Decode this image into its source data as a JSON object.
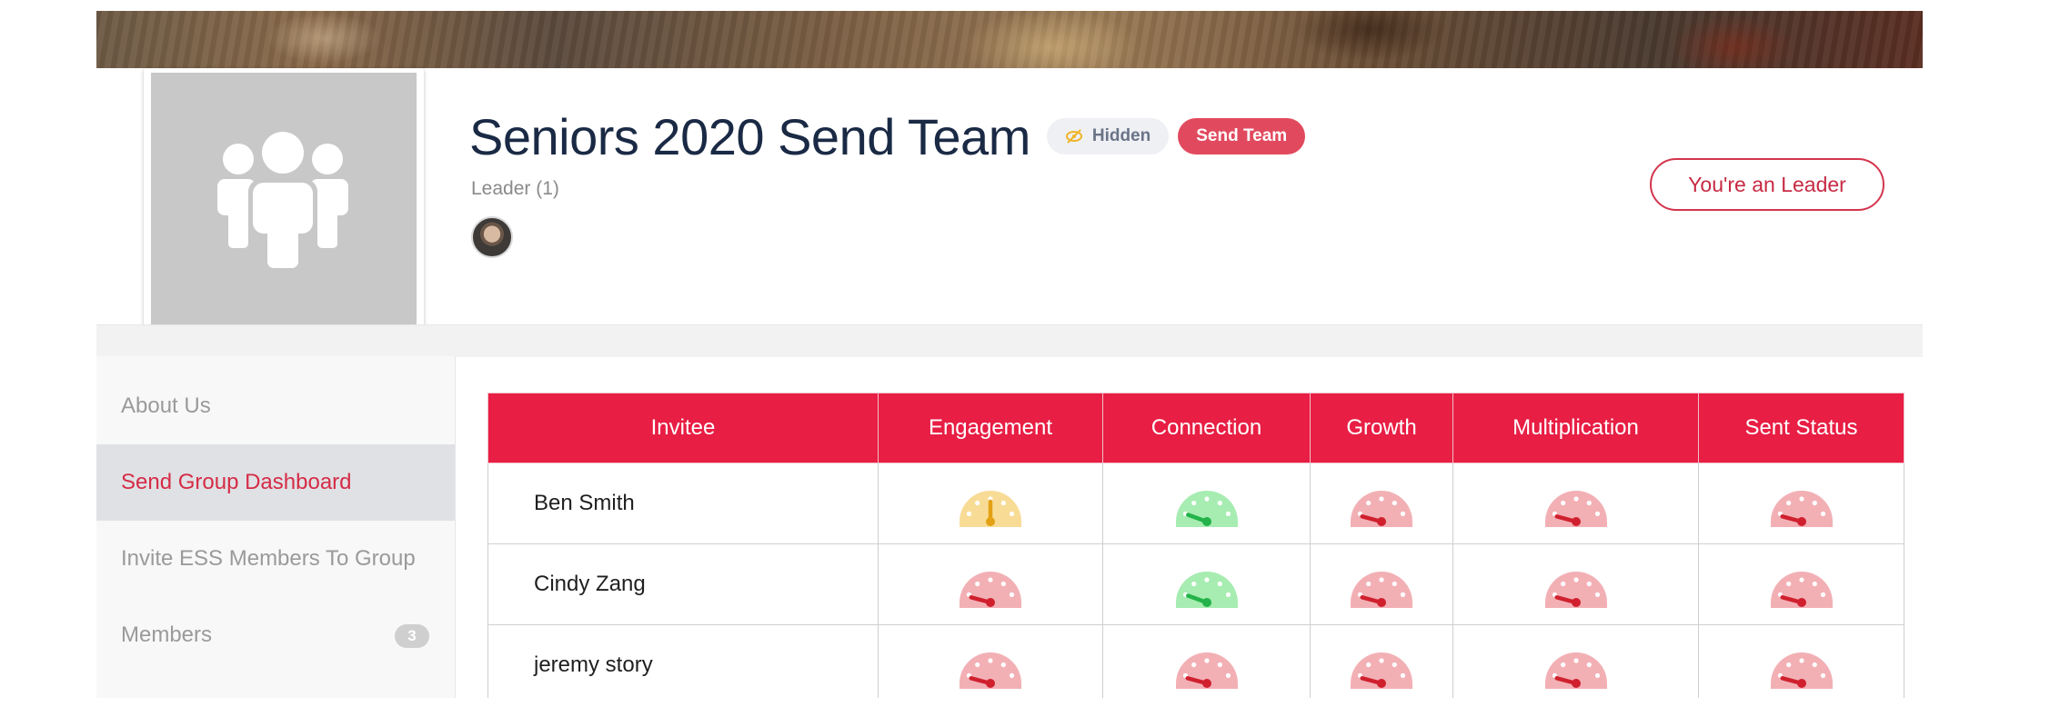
{
  "header": {
    "title": "Seniors 2020 Send Team",
    "badges": {
      "hidden": "Hidden",
      "type": "Send Team"
    },
    "leader_label": "Leader (1)",
    "leader_button": "You're an Leader"
  },
  "sidebar": {
    "items": [
      {
        "label": "About Us"
      },
      {
        "label": "Send Group Dashboard",
        "active": true
      },
      {
        "label": "Invite ESS Members To Group"
      },
      {
        "label": "Members",
        "count": "3"
      }
    ]
  },
  "table": {
    "columns": [
      "Invitee",
      "Engagement",
      "Connection",
      "Growth",
      "Multiplication",
      "Sent Status"
    ],
    "rows": [
      {
        "name": "Ben Smith",
        "gauges": [
          "yellow",
          "green",
          "red",
          "red",
          "red"
        ]
      },
      {
        "name": "Cindy Zang",
        "gauges": [
          "red",
          "green",
          "red",
          "red",
          "red"
        ]
      },
      {
        "name": "jeremy story",
        "gauges": [
          "red",
          "red",
          "red",
          "red",
          "red"
        ]
      }
    ]
  },
  "colors": {
    "accent": "#e81e44",
    "gauge_red": "#f2b0b5",
    "gauge_red_needle": "#d0202e",
    "gauge_green": "#a7ecb1",
    "gauge_green_needle": "#23b34a",
    "gauge_yellow": "#f8dc96",
    "gauge_yellow_needle": "#e3a114"
  },
  "icons": {
    "group_avatar": "group-people-icon",
    "hidden": "eye-slash-icon",
    "gauge": "speedometer-gauge-icon"
  }
}
